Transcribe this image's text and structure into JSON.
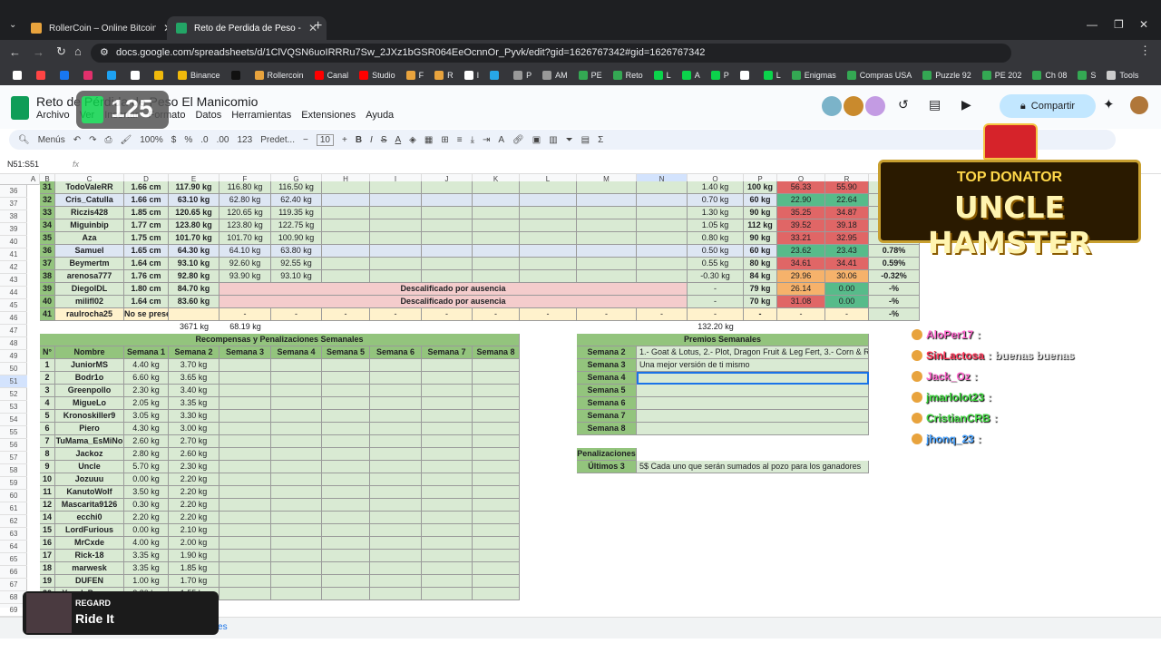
{
  "tabs": [
    {
      "title": "RollerCoin – Online Bitcoin Mini",
      "fav": "#e8a33d"
    },
    {
      "title": "Reto de Perdida de Peso - El Ma",
      "fav": "#23a566"
    }
  ],
  "url": "docs.google.com/spreadsheets/d/1ClVQSN6uoIRRRu7Sw_2JXz1bGSR064EeOcnnOr_Pyvk/edit?gid=1626767342#gid=1626767342",
  "bookmarks": [
    "",
    "",
    "",
    "",
    "",
    "",
    "",
    "Binance",
    "",
    "Rollercoin",
    "Canal",
    "Studio",
    "F",
    "R",
    "I",
    "",
    "P",
    "AM",
    "PE",
    "Reto",
    "L",
    "A",
    "P",
    "",
    "L",
    "Enigmas",
    "Compras USA",
    "Puzzle 92",
    "PE 202",
    "Ch 08",
    "S",
    "Tools"
  ],
  "doc": {
    "title": "Reto de Pérdida de Peso El Manicomio",
    "menus": [
      "Archivo",
      "Ver",
      "Insertar",
      "Formato",
      "Datos",
      "Herramientas",
      "Extensiones",
      "Ayuda"
    ],
    "share": "Compartir"
  },
  "toolbar": {
    "search": "Menús",
    "zoom": "100%",
    "currency": "$",
    "percent": "%",
    "dec0": ".0",
    "dec00": ".00",
    "num": "123",
    "font": "Predet...",
    "size": "10"
  },
  "namebox": "N51:S51",
  "fx": "fx",
  "columns": [
    "A",
    "B",
    "C",
    "D",
    "E",
    "F",
    "G",
    "H",
    "I",
    "J",
    "K",
    "L",
    "M",
    "N",
    "O",
    "P",
    "Q",
    "R"
  ],
  "rows": [
    "36",
    "37",
    "38",
    "39",
    "40",
    "41",
    "42",
    "43",
    "44",
    "45",
    "46",
    "47",
    "48",
    "49",
    "50",
    "51",
    "52",
    "53",
    "54",
    "55",
    "56",
    "57",
    "58",
    "59",
    "60",
    "61",
    "62",
    "63",
    "64",
    "65",
    "66",
    "67",
    "68",
    "69"
  ],
  "topTable": [
    {
      "n": "31",
      "name": "TodoValeRR",
      "h": "1.66 cm",
      "w1": "117.90 kg",
      "w2": "116.80 kg",
      "w3": "116.50 kg",
      "o": "1.40 kg",
      "p": "100 kg",
      "q": "56.33",
      "r": "55.90",
      "s": "",
      "qc": "red",
      "rc": "red",
      "blue": false
    },
    {
      "n": "32",
      "name": "Cris_Catulla",
      "h": "1.66 cm",
      "w1": "63.10 kg",
      "w2": "62.80 kg",
      "w3": "62.40 kg",
      "o": "0.70 kg",
      "p": "60 kg",
      "q": "22.90",
      "r": "22.64",
      "s": "",
      "qc": "gr",
      "rc": "gr",
      "blue": true
    },
    {
      "n": "33",
      "name": "Riczis428",
      "h": "1.85 cm",
      "w1": "120.65 kg",
      "w2": "120.65 kg",
      "w3": "119.35 kg",
      "o": "1.30 kg",
      "p": "90 kg",
      "q": "35.25",
      "r": "34.87",
      "s": "",
      "qc": "red",
      "rc": "red",
      "blue": false
    },
    {
      "n": "34",
      "name": "Miguinbip",
      "h": "1.77 cm",
      "w1": "123.80 kg",
      "w2": "123.80 kg",
      "w3": "122.75 kg",
      "o": "1.05 kg",
      "p": "112 kg",
      "q": "39.52",
      "r": "39.18",
      "s": "",
      "qc": "red",
      "rc": "red",
      "blue": false
    },
    {
      "n": "35",
      "name": "Aza",
      "h": "1.75 cm",
      "w1": "101.70 kg",
      "w2": "101.70 kg",
      "w3": "100.90 kg",
      "o": "0.80 kg",
      "p": "90 kg",
      "q": "33.21",
      "r": "32.95",
      "s": "",
      "qc": "red",
      "rc": "red",
      "blue": false
    },
    {
      "n": "36",
      "name": "Samuel",
      "h": "1.65 cm",
      "w1": "64.30 kg",
      "w2": "64.10 kg",
      "w3": "63.80 kg",
      "o": "0.50 kg",
      "p": "60 kg",
      "q": "23.62",
      "r": "23.43",
      "s": "0.78%",
      "qc": "gr",
      "rc": "gr",
      "blue": true
    },
    {
      "n": "37",
      "name": "Beymertm",
      "h": "1.64 cm",
      "w1": "93.10 kg",
      "w2": "92.60 kg",
      "w3": "92.55 kg",
      "o": "0.55 kg",
      "p": "80 kg",
      "q": "34.61",
      "r": "34.41",
      "s": "0.59%",
      "qc": "red",
      "rc": "red",
      "blue": false
    },
    {
      "n": "38",
      "name": "arenosa777",
      "h": "1.76 cm",
      "w1": "92.80 kg",
      "w2": "93.90 kg",
      "w3": "93.10 kg",
      "o": "-0.30 kg",
      "p": "84 kg",
      "q": "29.96",
      "r": "30.06",
      "s": "-0.32%",
      "qc": "or",
      "rc": "or",
      "blue": false
    },
    {
      "n": "39",
      "name": "DiegolDL",
      "h": "1.80 cm",
      "w1": "84.70 kg",
      "dq": "Descalificado por ausencia",
      "o": "-",
      "p": "79 kg",
      "q": "26.14",
      "r": "0.00",
      "s": "-%",
      "qc": "or",
      "rc": "gr"
    },
    {
      "n": "40",
      "name": "milifl02",
      "h": "1.64 cm",
      "w1": "83.60 kg",
      "dq": "Descalificado por ausencia",
      "o": "-",
      "p": "70 kg",
      "q": "31.08",
      "r": "0.00",
      "s": "-%",
      "qc": "red",
      "rc": "gr"
    },
    {
      "n": "41",
      "name": "raulrocha25",
      "h": "No se presentó",
      "w1": "",
      "o": "-",
      "p": "-",
      "q": "-",
      "r": "-",
      "s": "-%",
      "yellow": true
    }
  ],
  "totals": {
    "e": "3671 kg",
    "f": "68.19 kg",
    "o": "132.20 kg"
  },
  "rewards": {
    "title": "Recompensas y Penalizaciones Semanales",
    "headers": [
      "N°",
      "Nombre",
      "Semana 1",
      "Semana 2",
      "Semana 3",
      "Semana 4",
      "Semana 5",
      "Semana 6",
      "Semana 7",
      "Semana 8"
    ],
    "rows": [
      [
        "1",
        "JuniorMS",
        "4.40 kg",
        "3.70 kg"
      ],
      [
        "2",
        "Bodr1o",
        "6.60 kg",
        "3.65 kg"
      ],
      [
        "3",
        "Greenpollo",
        "2.30 kg",
        "3.40 kg"
      ],
      [
        "4",
        "MigueLo",
        "2.05 kg",
        "3.35 kg"
      ],
      [
        "5",
        "Kronoskiller9",
        "3.05 kg",
        "3.30 kg"
      ],
      [
        "6",
        "Piero",
        "4.30 kg",
        "3.00 kg"
      ],
      [
        "7",
        "TuMama_EsMiNo",
        "2.60 kg",
        "2.70 kg"
      ],
      [
        "8",
        "Jackoz",
        "2.80 kg",
        "2.60 kg"
      ],
      [
        "9",
        "Uncle",
        "5.70 kg",
        "2.30 kg"
      ],
      [
        "10",
        "Jozuuu",
        "0.00 kg",
        "2.20 kg"
      ],
      [
        "11",
        "KanutoWolf",
        "3.50 kg",
        "2.20 kg"
      ],
      [
        "12",
        "Mascarita9126",
        "0.30 kg",
        "2.20 kg"
      ],
      [
        "14",
        "ecchi0",
        "2.20 kg",
        "2.20 kg"
      ],
      [
        "15",
        "LordFurious",
        "0.00 kg",
        "2.10 kg"
      ],
      [
        "16",
        "MrCxde",
        "4.00 kg",
        "2.00 kg"
      ],
      [
        "17",
        "Rick-18",
        "3.35 kg",
        "1.90 kg"
      ],
      [
        "18",
        "marwesk",
        "3.35 kg",
        "1.85 kg"
      ],
      [
        "19",
        "DUFEN",
        "1.00 kg",
        "1.70 kg"
      ],
      [
        "20",
        "Yosel_Pegaso",
        "2.30 kg",
        "1.55 kg"
      ]
    ]
  },
  "prizes": {
    "title": "Premios Semanales",
    "rows": [
      [
        "Semana 2",
        "1.- Goat & Lotus, 2.- Plot, Dragon Fruit & Leg Fert, 3.- Corn & Radish"
      ],
      [
        "Semana 3",
        "Una mejor versión de ti mismo"
      ],
      [
        "Semana 4",
        ""
      ],
      [
        "Semana 5",
        ""
      ],
      [
        "Semana 6",
        ""
      ],
      [
        "Semana 7",
        ""
      ],
      [
        "Semana 8",
        ""
      ]
    ]
  },
  "penalties": {
    "title": "Penalizaciones",
    "label": "Últimos 3",
    "text": "5$ Cada uno que serán sumados al pozo para los ganadores"
  },
  "donator": {
    "line1": "TOP DONATOR",
    "line2": "UNCLE HAMSTER"
  },
  "chat": [
    {
      "user": "AloPer17",
      "msg": "",
      "color": "#ff66cc"
    },
    {
      "user": "SinLactosa",
      "msg": "buenas buenas",
      "color": "#ff3355"
    },
    {
      "user": "Jack_Oz",
      "msg": "",
      "color": "#ff66cc"
    },
    {
      "user": "jmarlolot23",
      "msg": "",
      "color": "#3ad43a"
    },
    {
      "user": "CristianCRB",
      "msg": "",
      "color": "#44d944"
    },
    {
      "user": "jhonq_23",
      "msg": "",
      "color": "#4aa3ff"
    }
  ],
  "overlay_badge": "125",
  "music": {
    "artist": "REGARD",
    "track": "Ride It"
  },
  "sheet_tab": "Reportes"
}
